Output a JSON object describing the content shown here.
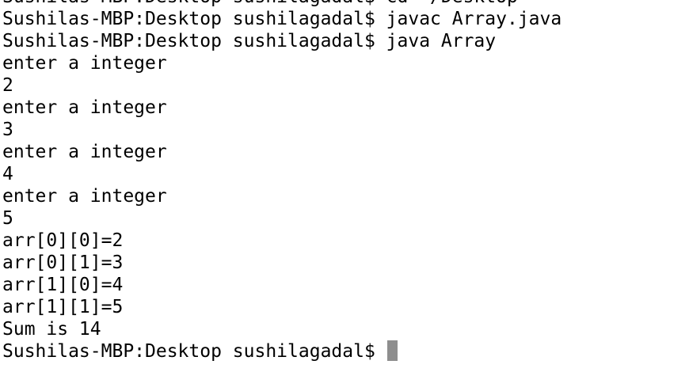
{
  "terminal": {
    "cursor_color": "#8e8e8e",
    "text_color": "#000000",
    "background_color": "#ffffff",
    "lines": [
      "Sushilas-MBP:Desktop sushilagadal$ cd ~/Desktop",
      "Sushilas-MBP:Desktop sushilagadal$ javac Array.java",
      "Sushilas-MBP:Desktop sushilagadal$ java Array",
      "enter a integer",
      "2",
      "enter a integer",
      "3",
      "enter a integer",
      "4",
      "enter a integer",
      "5",
      "arr[0][0]=2",
      "arr[0][1]=3",
      "arr[1][0]=4",
      "arr[1][1]=5",
      "Sum is 14"
    ],
    "prompt": "Sushilas-MBP:Desktop sushilagadal$"
  }
}
